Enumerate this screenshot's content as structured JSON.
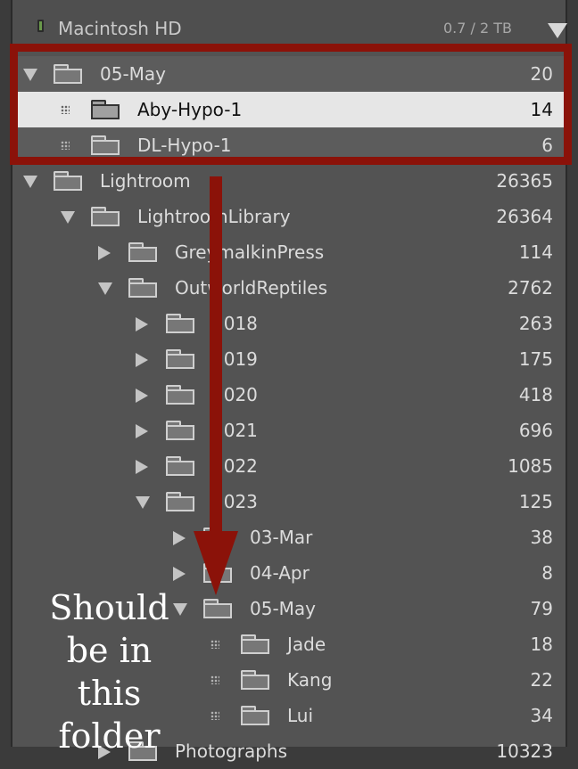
{
  "volume": {
    "name": "Macintosh HD",
    "size": "0.7 / 2 TB"
  },
  "tree": [
    {
      "label": "05-May",
      "count": "20",
      "state": "open"
    },
    {
      "label": "Aby-Hypo-1",
      "count": "14",
      "state": "leaf",
      "selected": true
    },
    {
      "label": "DL-Hypo-1",
      "count": "6",
      "state": "leaf"
    },
    {
      "label": "Lightroom",
      "count": "26365",
      "state": "open"
    },
    {
      "label": "LightroomLibrary",
      "count": "26364",
      "state": "open"
    },
    {
      "label": "GreymalkinPress",
      "count": "114",
      "state": "closed"
    },
    {
      "label": "OutworldReptiles",
      "count": "2762",
      "state": "open"
    },
    {
      "label": "2018",
      "count": "263",
      "state": "closed"
    },
    {
      "label": "2019",
      "count": "175",
      "state": "closed"
    },
    {
      "label": "2020",
      "count": "418",
      "state": "closed"
    },
    {
      "label": "2021",
      "count": "696",
      "state": "closed"
    },
    {
      "label": "2022",
      "count": "1085",
      "state": "closed"
    },
    {
      "label": "2023",
      "count": "125",
      "state": "open"
    },
    {
      "label": "03-Mar",
      "count": "38",
      "state": "closed"
    },
    {
      "label": "04-Apr",
      "count": "8",
      "state": "closed"
    },
    {
      "label": "05-May",
      "count": "79",
      "state": "open"
    },
    {
      "label": "Jade",
      "count": "18",
      "state": "leaf"
    },
    {
      "label": "Kang",
      "count": "22",
      "state": "leaf"
    },
    {
      "label": "Lui",
      "count": "34",
      "state": "leaf"
    },
    {
      "label": "Photographs",
      "count": "10323",
      "state": "closed"
    }
  ],
  "annotation": {
    "line1": "Should",
    "line2": "be in",
    "line3": "this folder"
  },
  "colors": {
    "annotation_red": "#8b1209",
    "panel_bg": "#535353",
    "selected_bg": "#e6e6e6"
  }
}
